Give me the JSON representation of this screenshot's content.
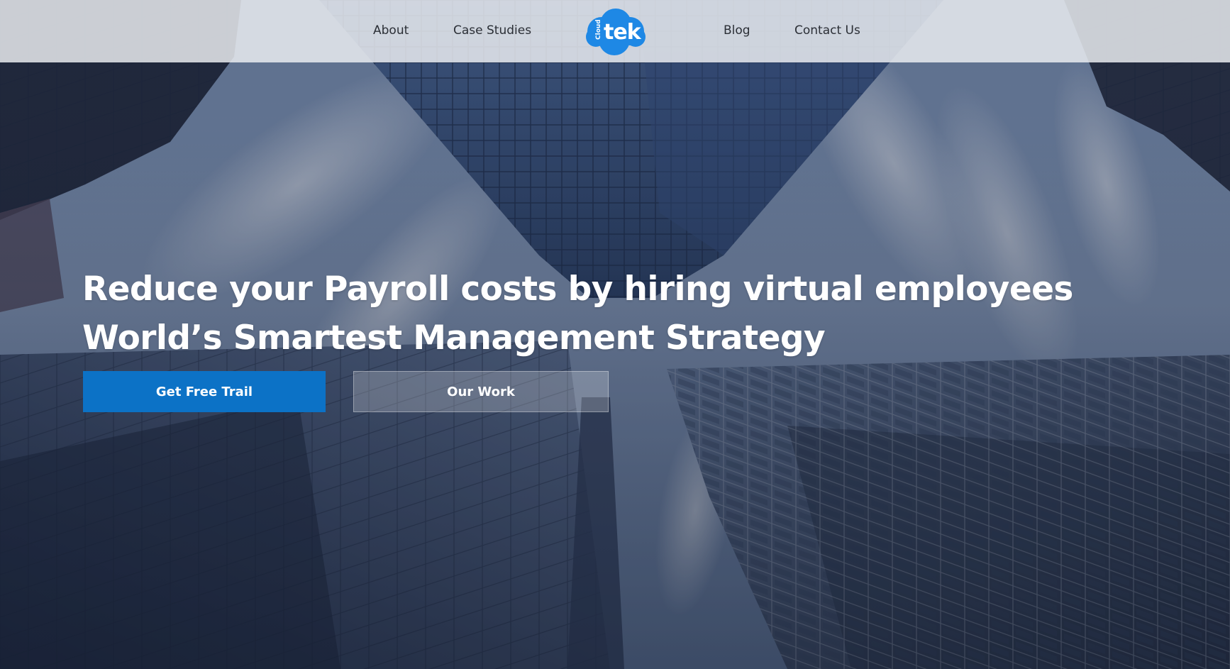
{
  "nav": {
    "links": [
      {
        "label": "About"
      },
      {
        "label": "Case Studies"
      },
      {
        "label": "Blog"
      },
      {
        "label": "Contact Us"
      }
    ],
    "logo": {
      "small_text": "Cloud",
      "main_text": "tek",
      "color": "#1e88e5"
    }
  },
  "hero": {
    "headline_line1": "Reduce your Payroll costs by hiring virtual employees",
    "headline_line2": "World’s Smartest Management Strategy",
    "primary_button": "Get Free Trail",
    "secondary_button": "Our Work",
    "primary_color": "#0c72c6"
  }
}
